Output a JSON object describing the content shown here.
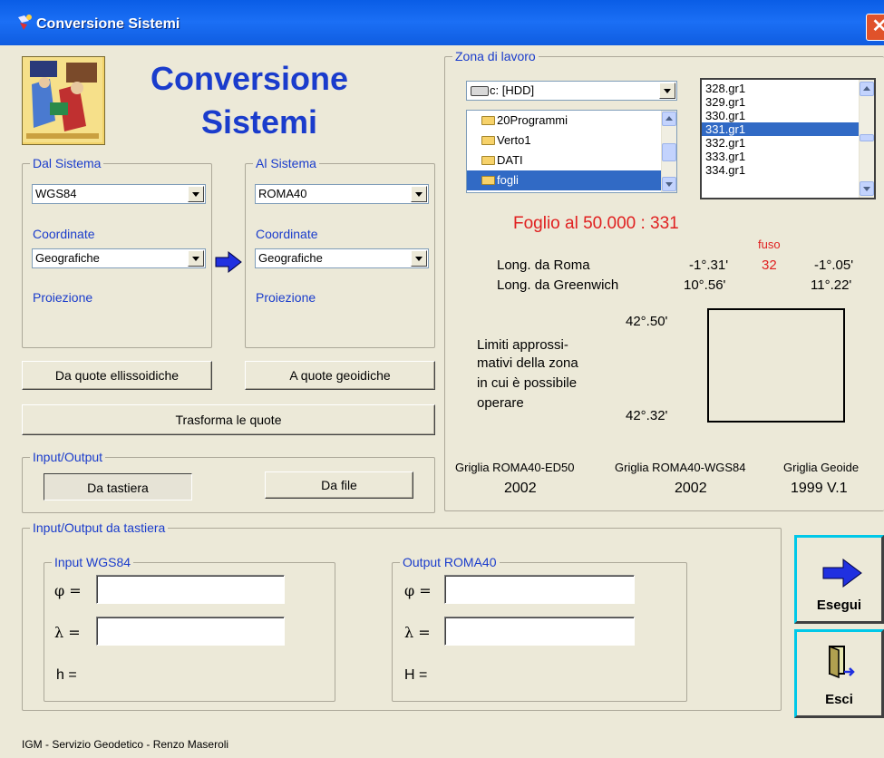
{
  "window": {
    "title": "Conversione Sistemi",
    "close_glyph": "✕"
  },
  "header": {
    "title_line1": "Conversione",
    "title_line2": "Sistemi"
  },
  "from_system": {
    "legend": "Dal Sistema",
    "system": "WGS84",
    "coord_label": "Coordinate",
    "coord_value": "Geografiche",
    "proj_label": "Proiezione"
  },
  "to_system": {
    "legend": "Al Sistema",
    "system": "ROMA40",
    "coord_label": "Coordinate",
    "coord_value": "Geografiche",
    "proj_label": "Proiezione"
  },
  "buttons": {
    "from_heights": "Da quote ellissoidiche",
    "to_heights": "A quote geoidiche",
    "transform": "Trasforma le quote",
    "keyboard": "Da tastiera",
    "file": "Da file",
    "run": "Esegui",
    "exit": "Esci"
  },
  "io": {
    "legend": "Input/Output"
  },
  "workzone": {
    "legend": "Zona di lavoro",
    "drive": "c: [HDD]",
    "folders": [
      "20Programmi",
      "Verto1",
      "DATI",
      "fogli"
    ],
    "files": [
      "328.gr1",
      "329.gr1",
      "330.gr1",
      "331.gr1",
      "332.gr1",
      "333.gr1",
      "334.gr1"
    ],
    "selected_file": "331.gr1",
    "sheet": "Foglio al 50.000 :  331",
    "fuso_label": "fuso",
    "fuso_value": "32",
    "long_rome_label": "Long. da Roma",
    "long_rome_a": "-1°.31'",
    "long_rome_b": "-1°.05'",
    "long_gw_label": "Long. da Greenwich",
    "long_gw_a": "10°.56'",
    "long_gw_b": "11°.22'",
    "lat_top": "42°.50'",
    "lat_bottom": "42°.32'",
    "limits_text": [
      "Limiti approssi-",
      "mativi della zona",
      "in cui è possibile",
      "operare"
    ],
    "grids": [
      {
        "name": "Griglia ROMA40-ED50",
        "version": "2002"
      },
      {
        "name": "Griglia ROMA40-WGS84",
        "version": "2002"
      },
      {
        "name": "Griglia Geoide",
        "version": "1999 V.1"
      }
    ]
  },
  "keyboard_io": {
    "legend": "Input/Output da tastiera",
    "input_legend": "Input  WGS84",
    "output_legend": "Output  ROMA40",
    "phi": "φ =",
    "lambda": "λ =",
    "h_label": "h =",
    "H_label": "H =",
    "input_phi": "",
    "input_lambda": "",
    "output_phi": "",
    "output_lambda": ""
  },
  "footer": "IGM - Servizio Geodetico - Renzo Maseroli",
  "colors": {
    "accent_blue": "#1a3ccc",
    "red": "#e02020",
    "titlebar": "#0a5de6"
  }
}
